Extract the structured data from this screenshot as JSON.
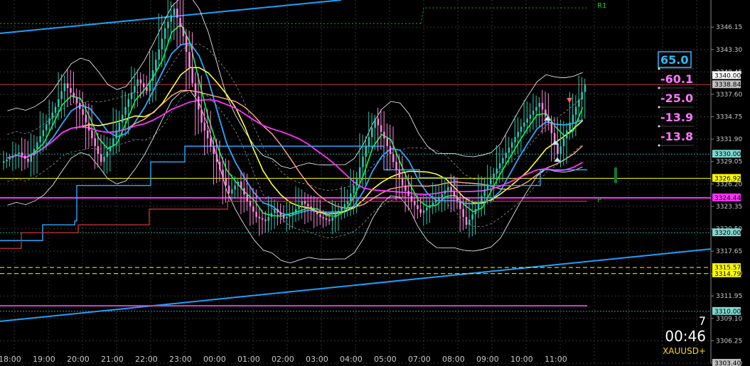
{
  "chart_data": {
    "type": "candlestick",
    "symbol": "XAUUSD+",
    "ylim": [
      3303.4,
      3349.6
    ],
    "x_ticks": [
      "18:00",
      "19:00",
      "20:00",
      "21:00",
      "22:00",
      "23:00",
      "00:00",
      "01:00",
      "02:00",
      "03:00",
      "04:00",
      "05:00",
      "07:00",
      "08:00",
      "09:00",
      "10:00",
      "11:00"
    ],
    "y_ticks": [
      3346.15,
      3343.3,
      3340.45,
      3337.6,
      3334.75,
      3331.9,
      3329.05,
      3326.2,
      3323.35,
      3320.5,
      3317.65,
      3314.8,
      3311.95,
      3309.1,
      3306.25,
      3303.4
    ],
    "price_tags": [
      {
        "label": "3340.00",
        "value": 3340.0,
        "bg": "#ffffff"
      },
      {
        "label": "3338.84",
        "value": 3338.84,
        "bg": "#c0c0c0"
      },
      {
        "label": "3330.00",
        "value": 3330.0,
        "bg": "#7fd8d0"
      },
      {
        "label": "3326.92",
        "value": 3326.92,
        "bg": "#ffff00"
      },
      {
        "label": "3324.44",
        "value": 3324.44,
        "bg": "#ff33ff"
      },
      {
        "label": "3320.00",
        "value": 3320.0,
        "bg": "#7fd8d0"
      },
      {
        "label": "3315.57",
        "value": 3315.57,
        "bg": "#ffff00"
      },
      {
        "label": "3314.79",
        "value": 3314.79,
        "bg": "#ffff00"
      },
      {
        "label": "3310.00",
        "value": 3310.0,
        "bg": "#7fd8d0"
      },
      {
        "label": "3303.40",
        "value": 3303.4,
        "bg": "#c0c0c0"
      }
    ],
    "levels": [
      {
        "name": "R1",
        "value": 3348.6,
        "color": "#22cc22"
      },
      {
        "name": "P",
        "value": 3323.6,
        "color": "#22cc22"
      }
    ],
    "scores": [
      {
        "label": "65.0",
        "color": "#33bbff",
        "boxed": true
      },
      {
        "label": "-60.1",
        "color": "#ff77ff",
        "boxed": false
      },
      {
        "label": "-25.0",
        "color": "#ff77ff",
        "boxed": false
      },
      {
        "label": "-13.9",
        "color": "#ff77ff",
        "boxed": false
      },
      {
        "label": "-13.8",
        "color": "#ff77ff",
        "boxed": false
      }
    ],
    "timer": {
      "count": "7",
      "time": "00:46",
      "symbol": "XAUUSD+"
    },
    "close_series": [
      3329.5,
      3330.2,
      3329.0,
      3331.5,
      3333.8,
      3336.0,
      3339.0,
      3337.2,
      3335.0,
      3332.0,
      3329.0,
      3331.0,
      3334.0,
      3337.0,
      3339.5,
      3338.0,
      3342.0,
      3346.0,
      3348.5,
      3345.0,
      3339.0,
      3334.0,
      3331.0,
      3328.0,
      3325.0,
      3326.5,
      3324.0,
      3322.0,
      3321.5,
      3323.0,
      3321.8,
      3322.5,
      3324.0,
      3323.0,
      3322.0,
      3321.5,
      3322.8,
      3324.0,
      3327.0,
      3331.0,
      3334.5,
      3332.0,
      3329.0,
      3326.0,
      3324.0,
      3322.5,
      3323.5,
      3324.5,
      3325.8,
      3324.0,
      3321.0,
      3323.0,
      3325.5,
      3327.5,
      3329.5,
      3331.5,
      3333.5,
      3335.0,
      3336.5,
      3334.0,
      3330.0,
      3333.0,
      3336.0,
      3338.84
    ]
  }
}
